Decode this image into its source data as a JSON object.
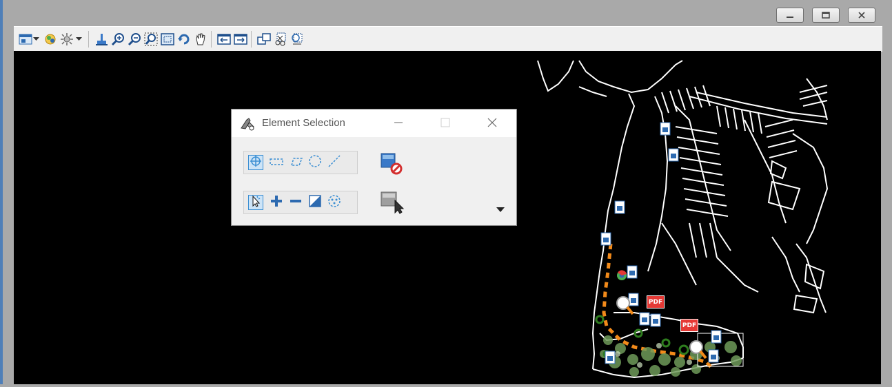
{
  "window": {
    "controls": [
      "minimize-icon",
      "restore-icon",
      "close-icon"
    ]
  },
  "toolbar": {
    "icons": [
      "view-attributes-icon",
      "dropdown-arrow-icon",
      "view-display-mode-icon",
      "lighting-icon",
      "dropdown-arrow-icon",
      "update-view-icon",
      "zoom-in-icon",
      "zoom-out-icon",
      "window-area-icon",
      "fit-view-icon",
      "rotate-view-icon",
      "pan-view-icon",
      "previous-view-icon",
      "next-view-icon",
      "copy-view-icon",
      "clip-volume-icon",
      "clip-mask-icon"
    ]
  },
  "dialog": {
    "title": "Element Selection",
    "method_tools": [
      "individual-method-icon",
      "block-method-icon",
      "shape-method-icon",
      "circle-method-icon",
      "line-method-icon"
    ],
    "mode_tools": [
      "new-mode-icon",
      "add-mode-icon",
      "subtract-mode-icon",
      "invert-mode-icon",
      "select-all-icon"
    ],
    "colors": {
      "accent": "#3c8fd3",
      "title_bg": "#ffffff",
      "body_bg": "#f0f0f0"
    }
  },
  "drawing": {
    "background": "#000000",
    "line_color": "#ffffff",
    "path_color": "#f28a1a",
    "pdf_label": "PDF"
  }
}
